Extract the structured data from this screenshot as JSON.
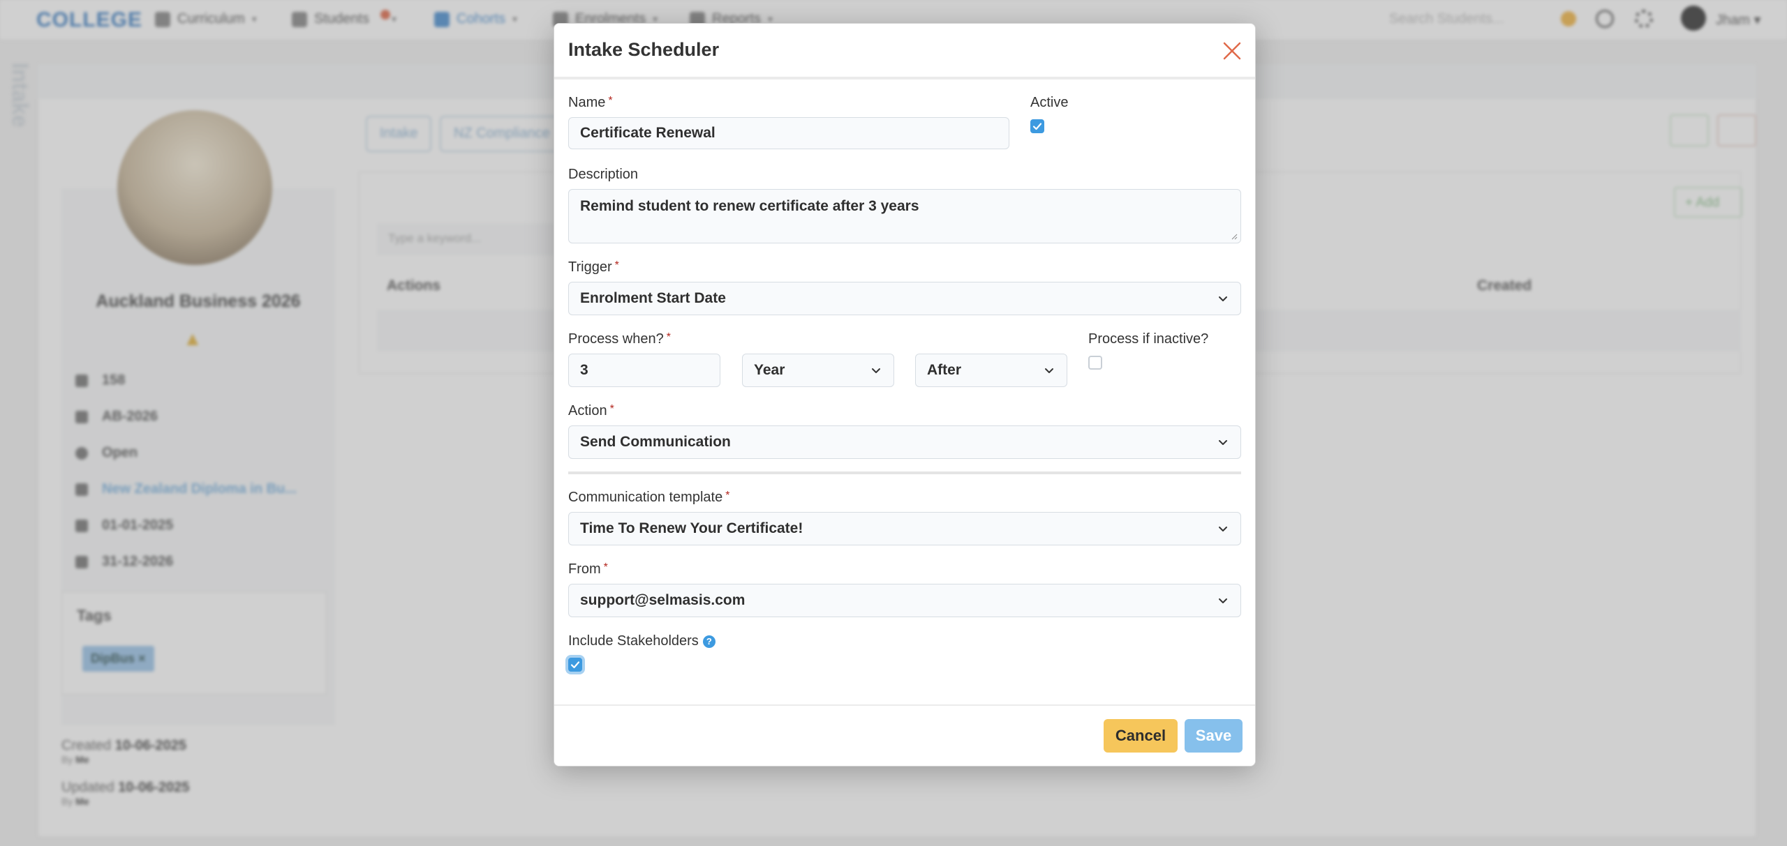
{
  "app": {
    "brand": "COLLEGE",
    "nav": [
      {
        "label": "Curriculum"
      },
      {
        "label": "Students"
      },
      {
        "label": "Cohorts"
      },
      {
        "label": "Enrolments"
      },
      {
        "label": "Reports"
      }
    ],
    "search_placeholder": "Search Students...",
    "user": "Jham",
    "side_tab": "Intake"
  },
  "background": {
    "intake_name": "Auckland Business 2026",
    "info": [
      {
        "icon": "hash-icon",
        "value": "158"
      },
      {
        "icon": "barcode-icon",
        "value": "AB-2026"
      },
      {
        "icon": "status-icon",
        "value": "Open"
      },
      {
        "icon": "program-icon",
        "value": "New Zealand Diploma in Bu..."
      },
      {
        "icon": "calendar-icon",
        "value": "01-01-2025"
      },
      {
        "icon": "calendar-icon",
        "value": "31-12-2026"
      }
    ],
    "tags_title": "Tags",
    "tag": "DipBus",
    "created_label": "Created",
    "created_date": "10-06-2025",
    "created_by_prefix": "By",
    "created_by": "Me",
    "updated_label": "Updated",
    "updated_date": "10-06-2025",
    "updated_by_prefix": "By",
    "updated_by": "Me",
    "tabs": [
      "Intake",
      "NZ Compliance"
    ],
    "add_label": "+ Add",
    "keyword_placeholder": "Type a keyword...",
    "columns": [
      "Actions",
      "Created"
    ]
  },
  "modal": {
    "title": "Intake Scheduler",
    "name": {
      "label": "Name",
      "value": "Certificate Renewal"
    },
    "active": {
      "label": "Active",
      "checked": true
    },
    "description": {
      "label": "Description",
      "value": "Remind student to renew certificate after 3 years"
    },
    "trigger": {
      "label": "Trigger",
      "value": "Enrolment Start Date"
    },
    "process_when": {
      "label": "Process when?",
      "amount": "3",
      "unit": "Year",
      "direction": "After"
    },
    "process_inactive": {
      "label": "Process if inactive?",
      "checked": false
    },
    "action": {
      "label": "Action",
      "value": "Send Communication"
    },
    "template": {
      "label": "Communication template",
      "value": "Time To Renew Your Certificate!"
    },
    "from": {
      "label": "From",
      "value": "support@selmasis.com"
    },
    "stakeholders": {
      "label": "Include Stakeholders",
      "hint": "?",
      "checked": true
    },
    "cancel_label": "Cancel",
    "save_label": "Save",
    "required_mark": "*"
  },
  "colors": {
    "accent": "#3d9ae0",
    "cancel": "#f6c65b",
    "save": "#86c0ec",
    "required": "#b3261e",
    "close": "#e06a4a"
  }
}
